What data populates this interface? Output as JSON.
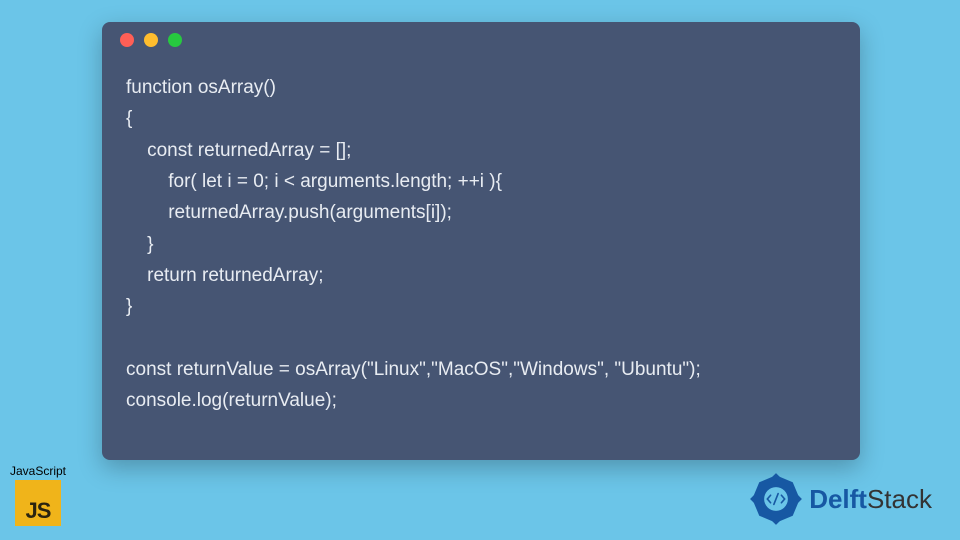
{
  "window": {
    "dots": [
      "red",
      "yellow",
      "green"
    ]
  },
  "code": {
    "lines": [
      "function osArray()",
      "{",
      "    const returnedArray = [];",
      "        for( let i = 0; i < arguments.length; ++i ){",
      "        returnedArray.push(arguments[i]);",
      "    }",
      "    return returnedArray;",
      "}",
      "",
      "const returnValue = osArray(\"Linux\",\"MacOS\",\"Windows\", \"Ubuntu\");",
      "console.log(returnValue);"
    ]
  },
  "badge": {
    "language_label": "JavaScript",
    "language_logo_text": "JS"
  },
  "brand": {
    "name_primary": "Delft",
    "name_secondary": "Stack",
    "logo_colors": {
      "primary": "#1758a3",
      "accent": "#6bc5e8"
    }
  }
}
